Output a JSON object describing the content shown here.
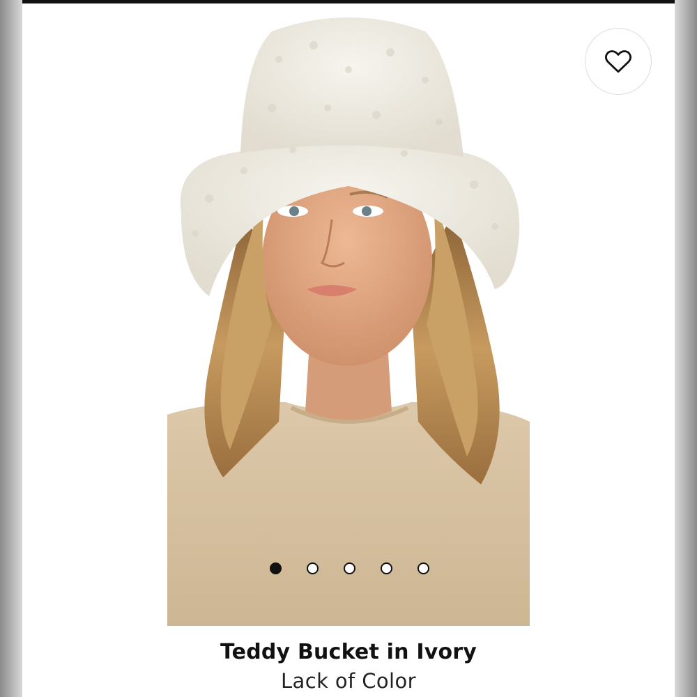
{
  "product": {
    "title": "Teddy Bucket in Ivory",
    "brand": "Lack of Color"
  },
  "favorite": {
    "icon": "heart-icon"
  },
  "carousel": {
    "total_images": 5,
    "active_index": 0
  },
  "colors": {
    "hat": "#efece4",
    "shirt": "#d6c1a2",
    "hair": "#b98c52",
    "skin": "#e0a983",
    "accent": "#111111"
  }
}
